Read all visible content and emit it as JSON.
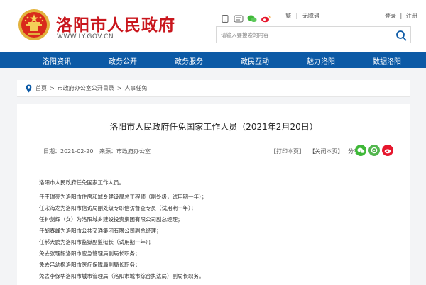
{
  "site": {
    "name": "洛阳市人民政府",
    "url": "WWW.LY.GOV.CN",
    "emblem": "national-emblem"
  },
  "toolbar": {
    "icons": [
      "mobile-icon",
      "wechat-app-icon",
      "wechat-icon",
      "weibo-icon"
    ],
    "links": [
      "|",
      "繁",
      "|",
      "无障碍"
    ],
    "login": "登录",
    "separator": "|",
    "register": "注册"
  },
  "search": {
    "placeholder": "请输入要搜索的内容"
  },
  "nav": {
    "items": [
      "洛阳资讯",
      "政务公开",
      "政务服务",
      "政民互动",
      "魅力洛阳",
      "数据洛阳"
    ]
  },
  "breadcrumb": {
    "items": [
      "首页",
      "市政府办公室公开目录",
      "人事任免"
    ],
    "separator": ">"
  },
  "article": {
    "title": "洛阳市人民政府任免国家工作人员（2021年2月20日）",
    "date_label": "日期：2021-02-20",
    "source_label": "来源：市政府办公室",
    "print_label": "【打印本页】",
    "close_label": "【关闭本页】",
    "share_label": "分享：",
    "share_icons": [
      "wechat-icon",
      "wechat-moments-icon",
      "weibo-icon"
    ],
    "colors": {
      "wechat": "#3fb838",
      "moments": "#53b64f",
      "weibo": "#e6162d"
    },
    "paragraphs": [
      "洛阳市人民政府任免国家工作人员。",
      "任王瑞亮为洛阳市住房和城乡建设局总工程师（副处级，试用期一年）；",
      "任宋海龙为洛阳市信访局副处级专职信访督查专员（试用期一年）；",
      "任钟剑辉（女）为洛阳城乡建设投资集团有限公司副总经理；",
      "任胡春峰为洛阳市公共交通集团有限公司副总经理；",
      "任郝大鹏为洛阳市监狱副监狱长（试用期一年）；",
      "免去张理毅洛阳市应急管理局副局长职务；",
      "免去吕幼枫洛阳市医疗保障局副局长职务；",
      "免去李保华洛阳市城市管理局（洛阳市城市综合执法局）副局长职务。"
    ]
  },
  "colors": {
    "brand_red": "#c9161d",
    "nav_blue": "#0c5aa6"
  }
}
